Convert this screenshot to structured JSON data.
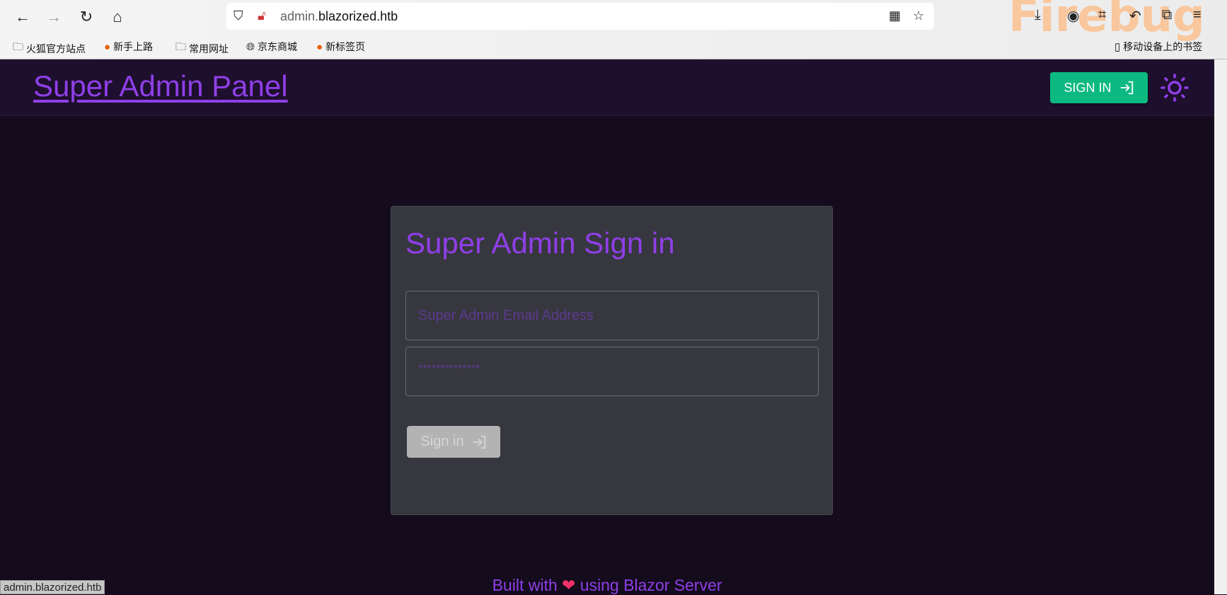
{
  "browser": {
    "url_prefix": "admin.",
    "url_domain": "blazorized.htb",
    "theme_text": "Firebug",
    "bookmarks": [
      {
        "label": "火狐官方站点",
        "icon": "folder-icon"
      },
      {
        "label": "新手上路",
        "icon": "firefox-icon"
      },
      {
        "label": "常用网址",
        "icon": "folder-icon"
      },
      {
        "label": "京东商城",
        "icon": "globe-icon"
      },
      {
        "label": "新标签页",
        "icon": "firefox-icon"
      }
    ],
    "mobile_bookmarks": "移动设备上的书签",
    "status_url": "admin.blazorized.htb"
  },
  "header": {
    "brand": "Super Admin Panel",
    "signin_label": "SIGN IN"
  },
  "login": {
    "title": "Super Admin Sign in",
    "email_placeholder": "Super Admin Email Address",
    "password_placeholder": "**************",
    "submit_label": "Sign in"
  },
  "footer": {
    "pre": "Built with",
    "post": "using Blazor Server"
  },
  "colors": {
    "accent": "#8f3fe8",
    "success": "#0cb981",
    "card": "#37373f",
    "background": "#140b1c",
    "header": "#1e0f2e"
  }
}
